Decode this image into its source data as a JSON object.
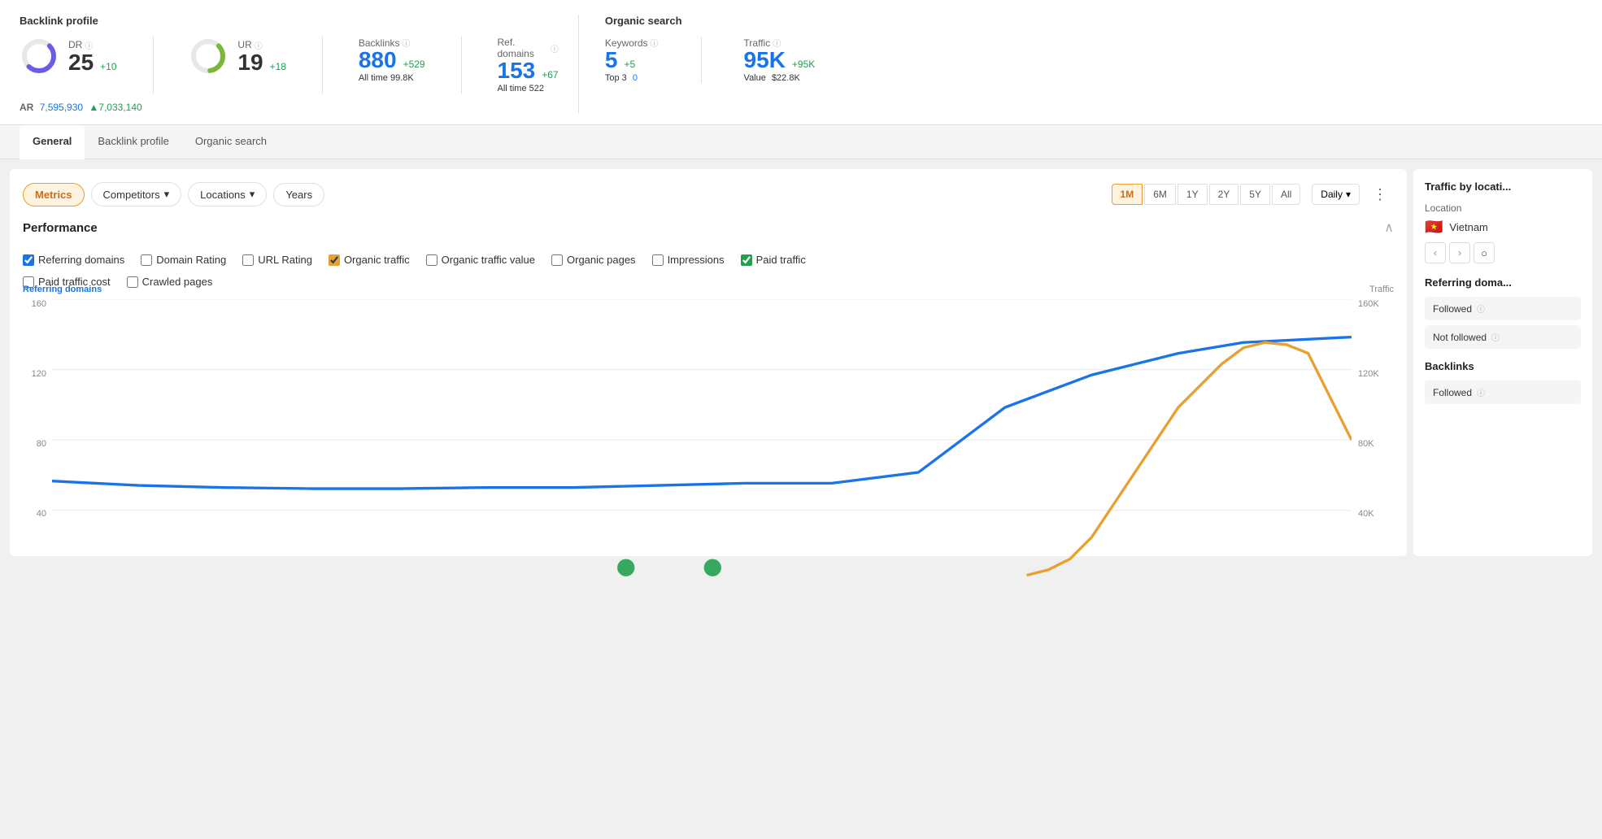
{
  "backlink_profile": {
    "title": "Backlink profile",
    "dr": {
      "label": "DR",
      "value": "25",
      "delta": "+10"
    },
    "ur": {
      "label": "UR",
      "value": "19",
      "delta": "+18"
    },
    "ar": {
      "label": "AR",
      "value": "7,595,930",
      "delta": "▲7,033,140"
    },
    "backlinks": {
      "label": "Backlinks",
      "value": "880",
      "delta": "+529",
      "sub_label": "All time",
      "sub_value": "99.8K"
    },
    "ref_domains": {
      "label": "Ref. domains",
      "value": "153",
      "delta": "+67",
      "sub_label": "All time",
      "sub_value": "522"
    }
  },
  "organic_search": {
    "title": "Organic search",
    "keywords": {
      "label": "Keywords",
      "value": "5",
      "delta": "+5",
      "sub_label": "Top 3",
      "sub_value": "0"
    },
    "traffic": {
      "label": "Traffic",
      "value": "95K",
      "delta": "+95K",
      "sub_label": "Value",
      "sub_value": "$22.8K"
    }
  },
  "nav_tabs": [
    {
      "label": "General",
      "active": true
    },
    {
      "label": "Backlink profile",
      "active": false
    },
    {
      "label": "Organic search",
      "active": false
    }
  ],
  "toolbar": {
    "metrics_label": "Metrics",
    "competitors_label": "Competitors",
    "locations_label": "Locations",
    "years_label": "Years",
    "time_periods": [
      "1M",
      "6M",
      "1Y",
      "2Y",
      "5Y",
      "All"
    ],
    "active_period": "1M",
    "interval_label": "Daily"
  },
  "performance": {
    "title": "Performance",
    "checkboxes": [
      {
        "id": "cb_ref_domains",
        "label": "Referring domains",
        "checked": true,
        "color": "blue"
      },
      {
        "id": "cb_domain_rating",
        "label": "Domain Rating",
        "checked": false,
        "color": "default"
      },
      {
        "id": "cb_url_rating",
        "label": "URL Rating",
        "checked": false,
        "color": "default"
      },
      {
        "id": "cb_organic_traffic",
        "label": "Organic traffic",
        "checked": true,
        "color": "orange"
      },
      {
        "id": "cb_organic_value",
        "label": "Organic traffic value",
        "checked": false,
        "color": "default"
      },
      {
        "id": "cb_organic_pages",
        "label": "Organic pages",
        "checked": false,
        "color": "default"
      },
      {
        "id": "cb_impressions",
        "label": "Impressions",
        "checked": false,
        "color": "default"
      },
      {
        "id": "cb_paid_traffic",
        "label": "Paid traffic",
        "checked": true,
        "color": "green"
      },
      {
        "id": "cb_paid_cost",
        "label": "Paid traffic cost",
        "checked": false,
        "color": "default"
      },
      {
        "id": "cb_crawled",
        "label": "Crawled pages",
        "checked": false,
        "color": "default"
      }
    ]
  },
  "chart": {
    "axis_left_label": "Referring domains",
    "axis_right_label": "Traffic",
    "left_values": [
      "160",
      "120",
      "80",
      "40"
    ],
    "right_values": [
      "160K",
      "120K",
      "80K",
      "40K"
    ]
  },
  "right_panel": {
    "title": "Traffic by locati...",
    "location_label": "Location",
    "location_name": "Vietnam",
    "referring_domains_title": "Referring doma...",
    "followed_label": "Followed",
    "not_followed_label": "Not followed",
    "backlinks_title": "Backlinks",
    "backlinks_followed_label": "Followed"
  }
}
